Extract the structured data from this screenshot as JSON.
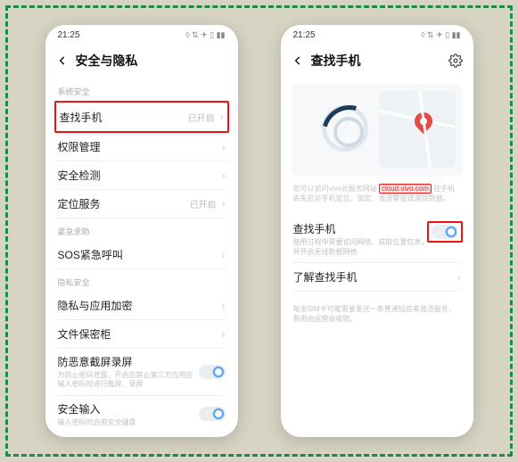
{
  "statusbar": {
    "time": "21:25"
  },
  "left": {
    "title": "安全与隐私",
    "section_system": "系统安全",
    "rows": {
      "find_phone": {
        "label": "查找手机",
        "value": "已开启"
      },
      "permissions": {
        "label": "权限管理"
      },
      "security_scan": {
        "label": "安全检测"
      },
      "location": {
        "label": "定位服务",
        "value": "已开启"
      }
    },
    "section_emergency": "紧急求助",
    "sos": {
      "label": "SOS紧急呼叫"
    },
    "section_privacy": "隐私安全",
    "app_encrypt": {
      "label": "隐私与应用加密"
    },
    "file_safe": {
      "label": "文件保密柜"
    },
    "anti_capture": {
      "label": "防恶意截屏录屏",
      "desc": "为防止密码泄露，开启后禁止第三方应用在输入密码时进行截屏、录屏"
    },
    "secure_input": {
      "label": "安全输入",
      "desc": "输入密码时启用安全键盘"
    }
  },
  "right": {
    "title": "查找手机",
    "intro_a": "您可以访问vivo云服务网站",
    "intro_url": "cloud.vivo.com",
    "intro_b": "在手机丢失后对手机定位、锁定、发送警报或清除数据。",
    "find": {
      "label": "查找手机",
      "desc": "使用过程中需要访问网络、获取位置信息，并开启无线数据网络"
    },
    "learn": {
      "label": "了解查找手机"
    },
    "footnote": "每张SIM卡可能需要发送一条普通短信来激活服务，费用由运营商收取。"
  }
}
